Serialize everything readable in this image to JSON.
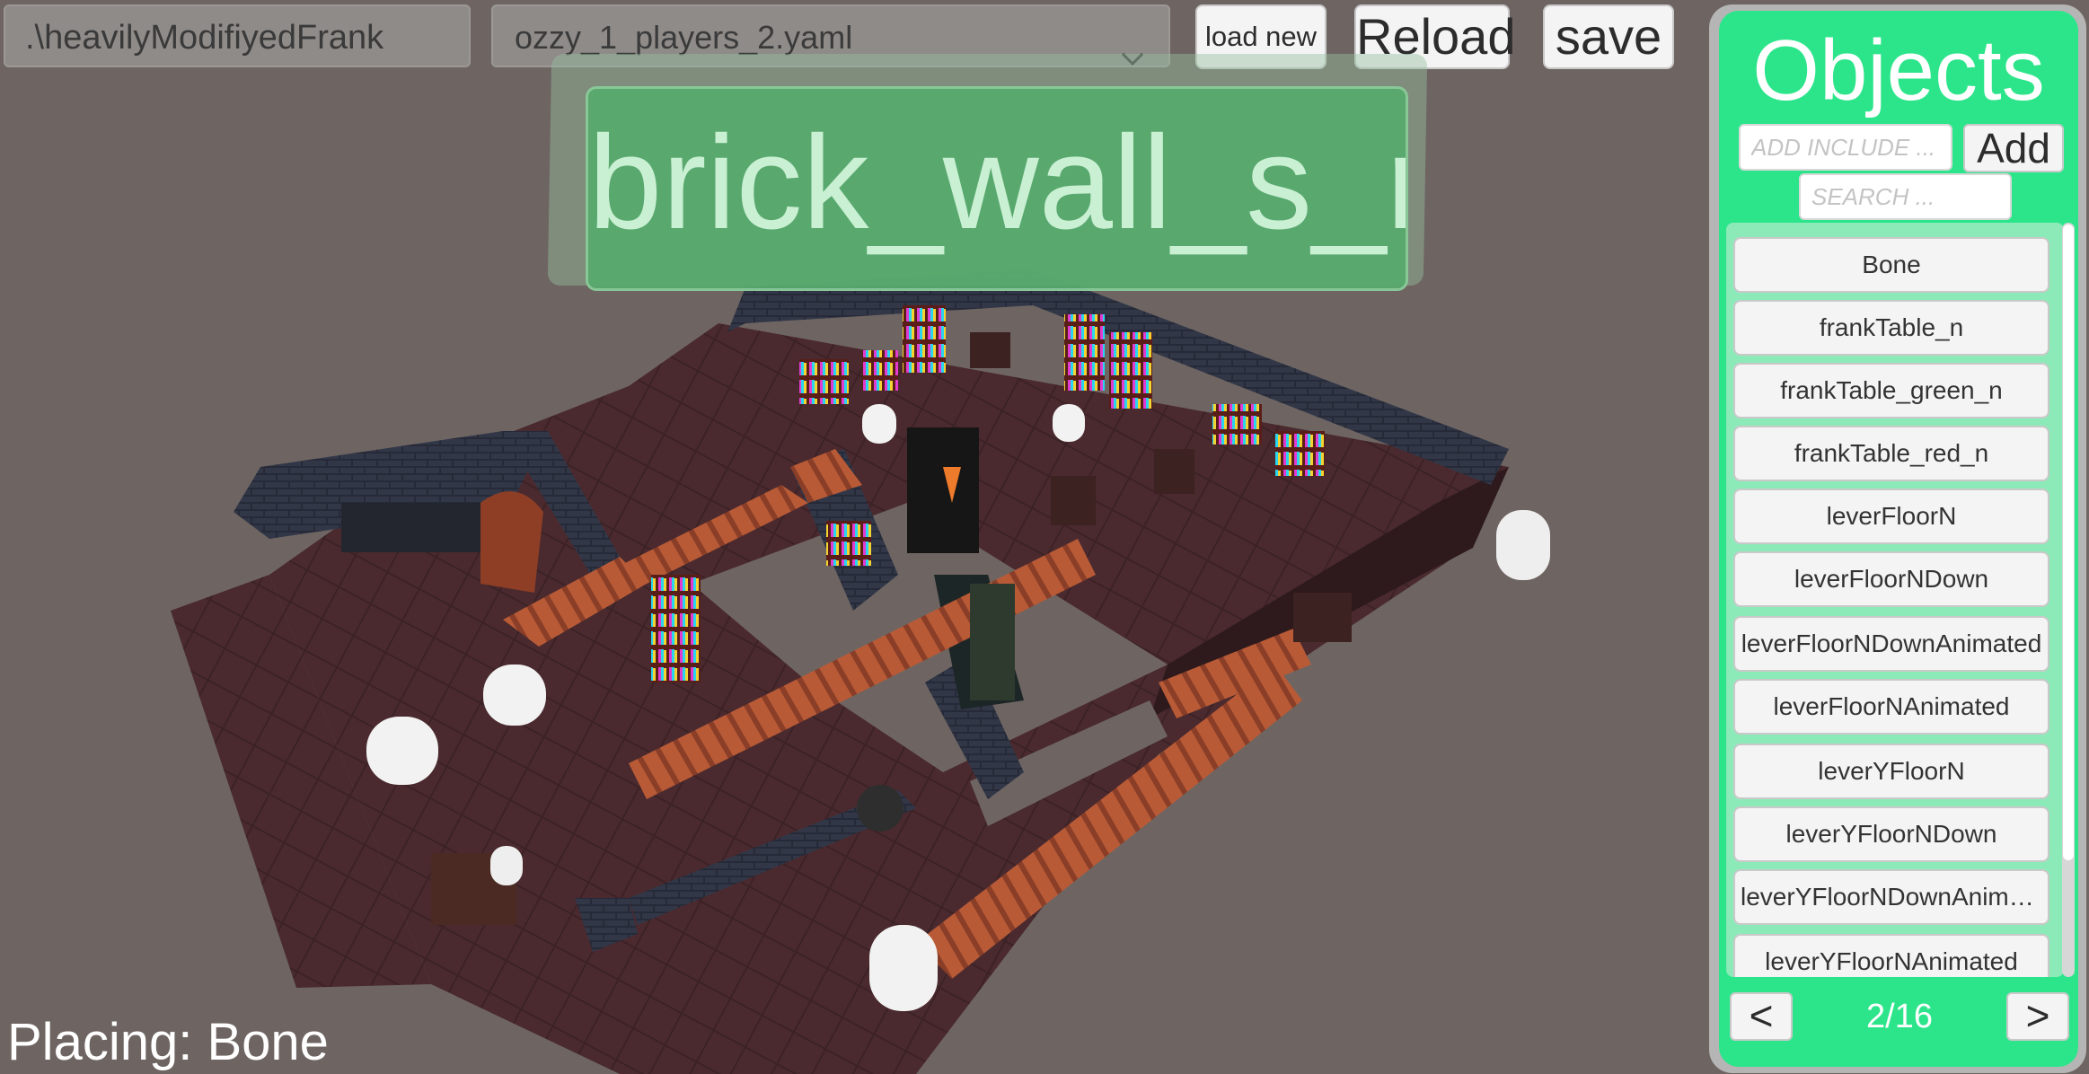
{
  "toolbar": {
    "path_value": ".\\heavilyModifiyedFrank",
    "file_selected": "ozzy_1_players_2.yaml",
    "load_new_label": "load new",
    "reload_label": "Reload",
    "save_label": "save"
  },
  "selection_banner": {
    "text": "brick_wall_s_rc"
  },
  "status": {
    "text": "Placing: Bone"
  },
  "panel": {
    "title": "Objects",
    "include_placeholder": "ADD INCLUDE ...",
    "add_label": "Add",
    "search_placeholder": "SEARCH ...",
    "items": [
      "Bone",
      "frankTable_n",
      "frankTable_green_n",
      "frankTable_red_n",
      "leverFloorN",
      "leverFloorNDown",
      "leverFloorNDownAnimated",
      "leverFloorNAnimated",
      "leverYFloorN",
      "leverYFloorNDown",
      "leverYFloorNDownAnimated",
      "leverYFloorNAnimated"
    ],
    "prev_label": "<",
    "next_label": ">",
    "page": "2/16"
  },
  "colors": {
    "panel_accent": "#2ce58a",
    "banner": "#56aa6e",
    "background": "#6e6562"
  }
}
